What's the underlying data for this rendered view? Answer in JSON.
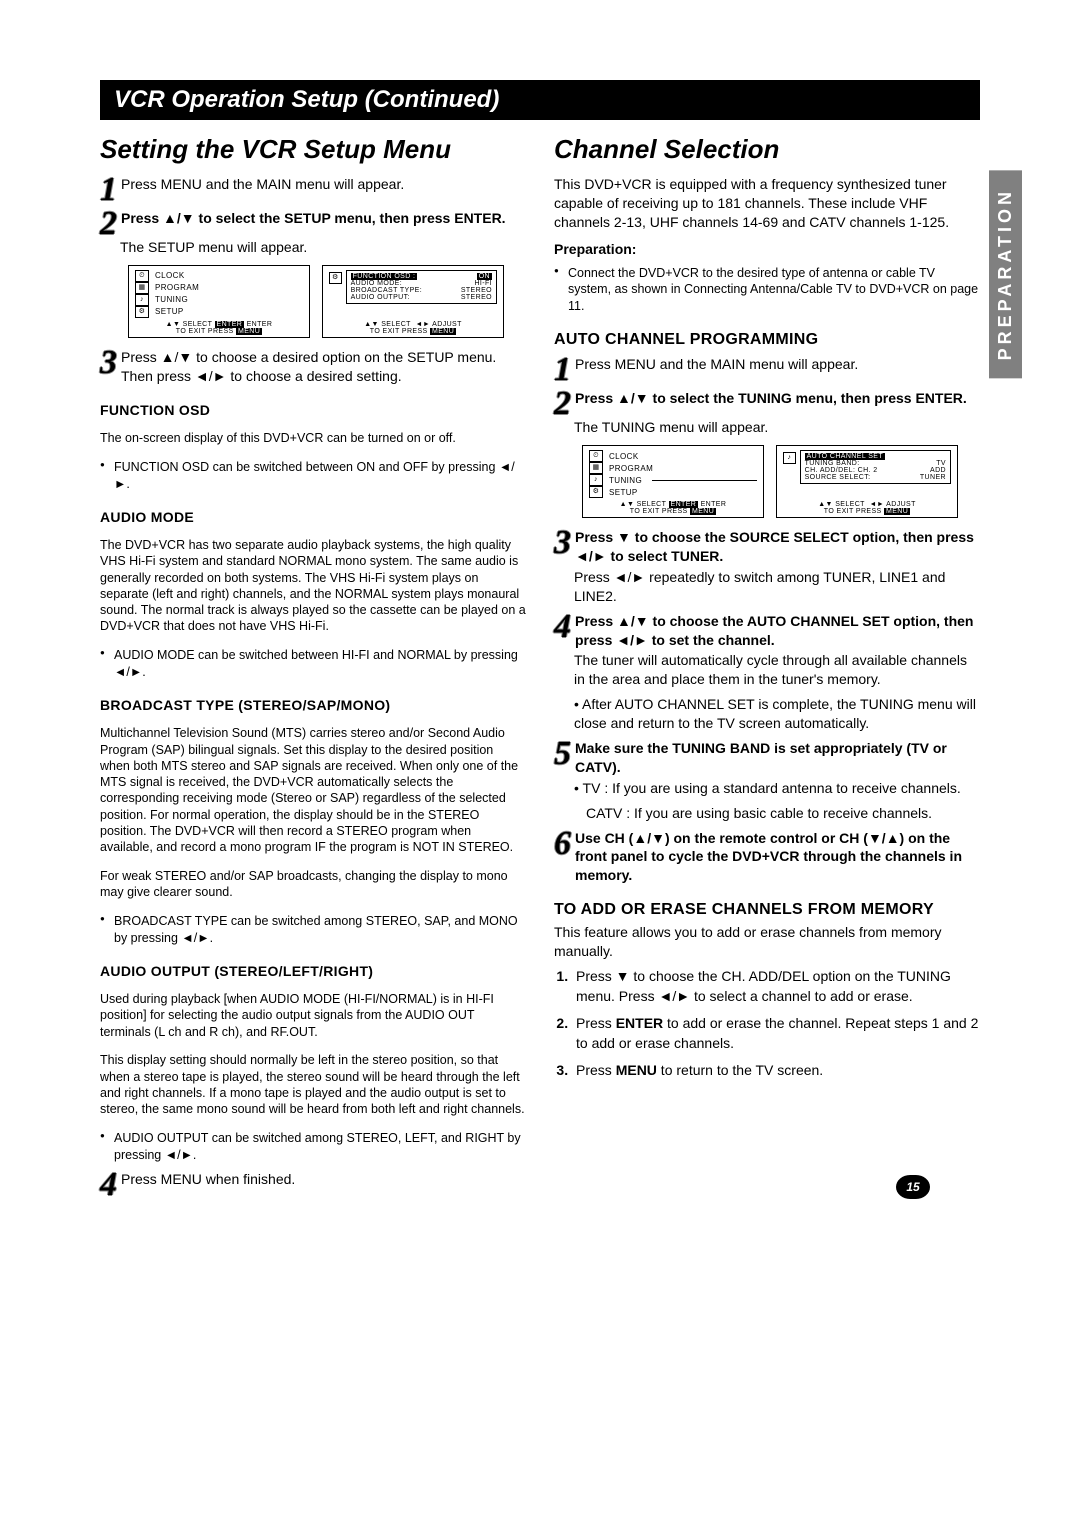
{
  "page_number": "15",
  "side_tab": "PREPARATION",
  "title_bar": "VCR Operation Setup (Continued)",
  "left": {
    "h1": "Setting the VCR Setup Menu",
    "step1": "Press MENU and the MAIN menu will appear.",
    "step2": "Press ▲/▼ to select the SETUP menu, then press ENTER.",
    "step2_after": "The SETUP menu will appear.",
    "step3": "Press ▲/▼ to choose a desired option on the SETUP menu. Then press ◄/► to choose a desired setting.",
    "func_osd_h": "FUNCTION OSD",
    "func_osd_p": "The on-screen display of this DVD+VCR can be turned on or off.",
    "func_osd_b": "FUNCTION OSD can be switched between ON and OFF by pressing ◄/►.",
    "audio_mode_h": "AUDIO MODE",
    "audio_mode_p": "The DVD+VCR has two separate audio playback systems, the high quality VHS Hi-Fi system and standard NORMAL mono system. The same audio is generally recorded on both systems. The VHS Hi-Fi system plays on separate (left and right) channels, and the NORMAL system plays monaural sound. The normal track is always played so the cassette can be played on a DVD+VCR that does not have VHS Hi-Fi.",
    "audio_mode_b": "AUDIO MODE can be switched between HI-FI and NORMAL by pressing ◄/►.",
    "btype_h": "BROADCAST TYPE (STEREO/SAP/MONO)",
    "btype_p1": "Multichannel Television Sound (MTS) carries stereo and/or Second Audio Program (SAP) bilingual signals. Set this display to the desired position when both MTS stereo and SAP signals are received. When only one of the MTS signal is received, the DVD+VCR automatically selects the corresponding receiving mode (Stereo or SAP) regardless of the selected position. For normal operation, the display should be in the STEREO position. The DVD+VCR will then record a STEREO program when available, and record a mono program IF the program is NOT IN STEREO.",
    "btype_p2": "For weak STEREO and/or SAP broadcasts, changing the display to mono may give clearer sound.",
    "btype_b": "BROADCAST TYPE can be switched among STEREO, SAP, and MONO by pressing ◄/►.",
    "aout_h": "AUDIO OUTPUT (STEREO/LEFT/RIGHT)",
    "aout_p1": "Used during playback [when AUDIO MODE (HI-FI/NORMAL) is in HI-FI position] for selecting the audio output signals from the AUDIO OUT terminals (L ch and R ch), and RF.OUT.",
    "aout_p2": "This display setting should normally be left in the stereo position, so that when a stereo tape is played, the stereo sound will be heard through the left and right channels. If a mono tape is played and the audio output is set to stereo, the same mono sound will be heard from both left and right channels.",
    "aout_b": "AUDIO OUTPUT can be switched among STEREO, LEFT, and RIGHT by pressing ◄/►.",
    "step4": "Press MENU when finished.",
    "osd_left": {
      "items": [
        "CLOCK",
        "PROGRAM",
        "TUNING",
        "SETUP"
      ],
      "footer_select": "SELECT",
      "footer_enter": "ENTER",
      "footer_exit": "TO  EXIT  PRESS",
      "footer_menu": "MENU"
    },
    "osd_right": {
      "rows": [
        [
          "FUNCTION OSD :",
          "ON"
        ],
        [
          "AUDIO MODE:",
          "HI-FI"
        ],
        [
          "BROADCAST TYPE:",
          "STEREO"
        ],
        [
          "AUDIO OUTPUT:",
          "STEREO"
        ]
      ],
      "footer_select": "SELECT",
      "footer_adjust": "ADJUST",
      "footer_exit": "TO  EXIT  PRESS",
      "footer_menu": "MENU"
    }
  },
  "right": {
    "h1": "Channel Selection",
    "intro": "This DVD+VCR is equipped with a frequency synthesized tuner capable of receiving up to 181 channels. These include VHF channels 2-13, UHF channels 14-69 and CATV channels 1-125.",
    "prep_h": "Preparation:",
    "prep_b": "Connect the DVD+VCR to the desired type of antenna or cable TV system, as shown in Connecting Antenna/Cable TV to DVD+VCR on page 11.",
    "auto_h": "AUTO CHANNEL PROGRAMMING",
    "step1": "Press MENU and the MAIN menu will appear.",
    "step2": "Press ▲/▼ to select the TUNING menu, then press ENTER.",
    "step2_after": "The TUNING menu will appear.",
    "step3": "Press ▼ to choose the SOURCE SELECT option, then press ◄/► to select TUNER.",
    "step3_after": "Press ◄/► repeatedly to switch among TUNER, LINE1 and LINE2.",
    "step4": "Press ▲/▼ to choose the AUTO CHANNEL SET option, then press ◄/► to set the channel.",
    "step4_p1": "The tuner will automatically cycle through all available channels in the area and place them in the tuner's memory.",
    "step4_p2": "• After AUTO CHANNEL SET is complete, the TUNING menu will close and return to the TV screen automatically.",
    "step5": "Make sure the TUNING BAND is set appropriately (TV or CATV).",
    "step5_p1": "• TV : If you are using a standard antenna to receive channels.",
    "step5_p2": "CATV : If you are using basic cable to receive channels.",
    "step6": "Use CH (▲/▼) on the remote control or CH (▼/▲) on the front panel to cycle the DVD+VCR through the channels in memory.",
    "adderase_h": "TO ADD OR ERASE CHANNELS FROM MEMORY",
    "adderase_p": "This feature allows you to add or erase channels from memory manually.",
    "li1": "Press ▼ to choose the CH. ADD/DEL option on the TUNING menu. Press ◄/► to select a channel to add or erase.",
    "li2_a": "Press ",
    "li2_b": "ENTER",
    "li2_c": " to add or erase the channel. Repeat steps 1 and 2 to add or erase channels.",
    "li3_a": "Press ",
    "li3_b": "MENU",
    "li3_c": " to return to the TV screen.",
    "osd_left": {
      "items": [
        "CLOCK",
        "PROGRAM",
        "TUNING",
        "SETUP"
      ],
      "footer_select": "SELECT",
      "footer_enter": "ENTER",
      "footer_exit": "TO  EXIT  PRESS",
      "footer_menu": "MENU"
    },
    "osd_right": {
      "rows": [
        [
          "AUTO CHANNEL SET",
          ""
        ],
        [
          "TUNING BAND:",
          "TV"
        ],
        [
          "CH. ADD/DEL: CH. 2",
          "ADD"
        ],
        [
          "SOURCE SELECT:",
          "TUNER"
        ]
      ],
      "footer_select": "SELECT",
      "footer_adjust": "ADJUST",
      "footer_exit": "TO  EXIT  PRESS",
      "footer_menu": "MENU"
    }
  }
}
